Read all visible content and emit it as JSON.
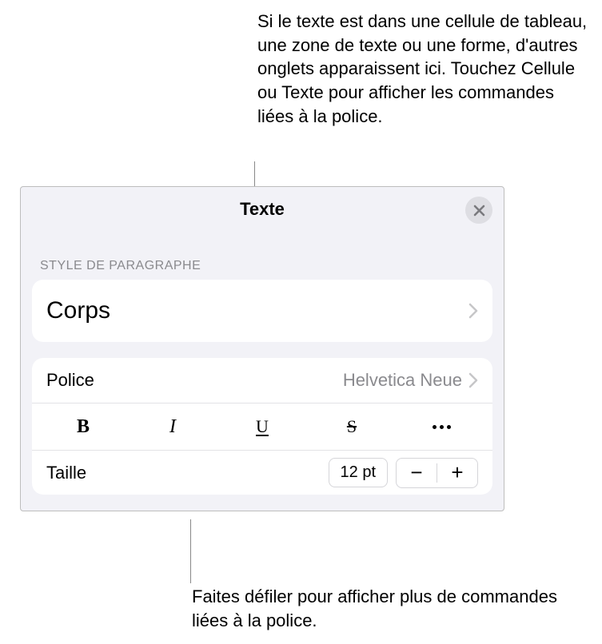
{
  "callouts": {
    "top": "Si le texte est dans une cellule de tableau, une zone de texte ou une forme, d'autres onglets apparaissent ici. Touchez Cellule ou Texte pour afficher les commandes liées à la police.",
    "bottom": "Faites défiler pour afficher plus de commandes liées à la police."
  },
  "panel": {
    "title": "Texte",
    "paragraph_style": {
      "label": "STYLE DE PARAGRAPHE",
      "value": "Corps"
    },
    "font": {
      "label": "Police",
      "value": "Helvetica Neue"
    },
    "format_buttons": {
      "bold": "B",
      "italic": "I",
      "underline": "U",
      "strike": "S"
    },
    "size": {
      "label": "Taille",
      "value": "12 pt",
      "minus": "−",
      "plus": "+"
    }
  }
}
